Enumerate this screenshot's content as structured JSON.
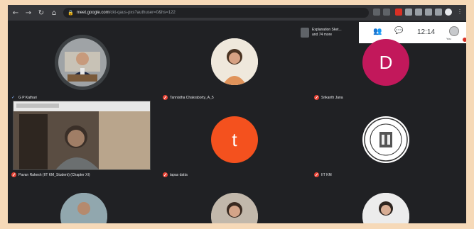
{
  "browser": {
    "url_host": "meet.google.com",
    "url_path": "/ckt-qaus-pxs?authuser=0&hs=122"
  },
  "overlay": {
    "pip_title": "Explanation Sket...",
    "pip_sub": "and 74 more",
    "clock": "12:14",
    "you_label": "You"
  },
  "participants": [
    {
      "name": "G P Kathari",
      "kind": "photo",
      "mic": "on"
    },
    {
      "name": "Tannistha Chakraborty_A_5",
      "kind": "photo",
      "mic": "off"
    },
    {
      "name": "Srikanth Jana",
      "kind": "letter",
      "letter": "D",
      "color": "#c2185b",
      "mic": "off"
    },
    {
      "name": "Pavan Rakesh (IIT KM_Student) (Chapter XI)",
      "kind": "video",
      "mic": "off"
    },
    {
      "name": "tapas datta",
      "kind": "letter",
      "letter": "t",
      "color": "#f4511e",
      "mic": "off"
    },
    {
      "name": "IIT KM",
      "kind": "seal",
      "mic": "off"
    },
    {
      "name": "",
      "kind": "photo",
      "mic": ""
    },
    {
      "name": "",
      "kind": "photo",
      "mic": ""
    },
    {
      "name": "",
      "kind": "photo",
      "mic": ""
    }
  ]
}
